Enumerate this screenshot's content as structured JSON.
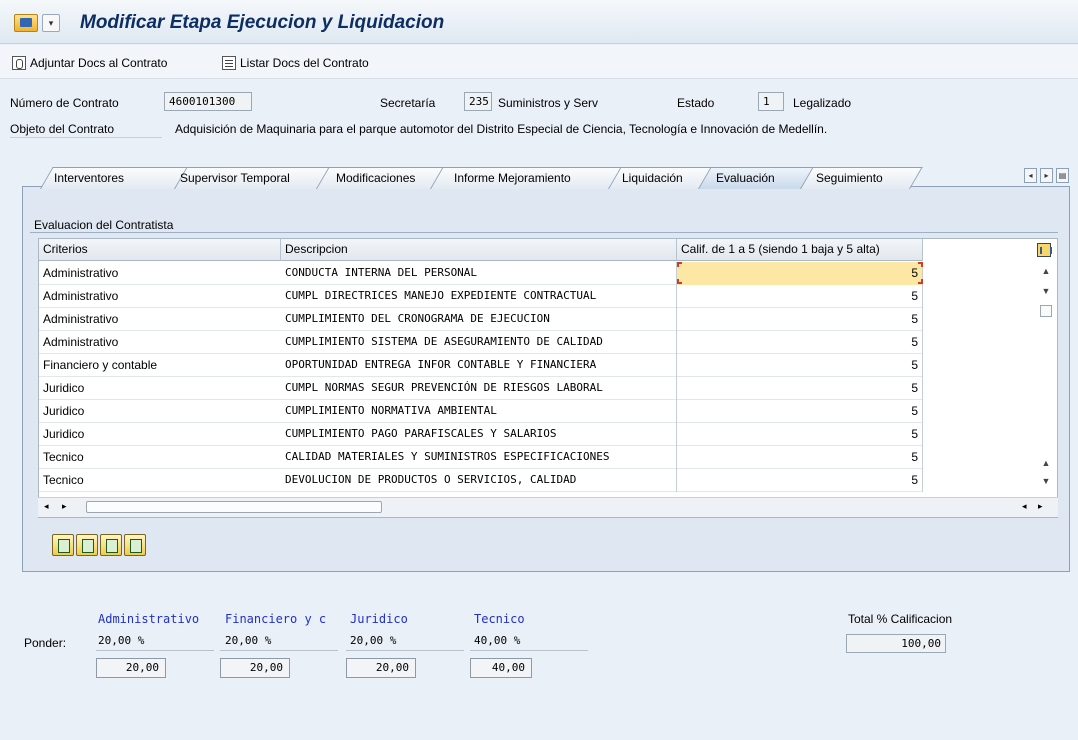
{
  "window": {
    "title": "Modificar Etapa Ejecucion y Liquidacion"
  },
  "toolbar": {
    "attach_label": "Adjuntar Docs al Contrato",
    "list_label": "Listar Docs del Contrato"
  },
  "header": {
    "contract_number_label": "Número de Contrato",
    "contract_number": "4600101300",
    "secretaria_label": "Secretaría",
    "secretaria_code": "235",
    "secretaria_name": "Suministros y Serv",
    "estado_label": "Estado",
    "estado_code": "1",
    "estado_name": "Legalizado",
    "objeto_label": "Objeto del Contrato",
    "objeto_text": "Adquisición de Maquinaria para el parque automotor del Distrito Especial de Ciencia, Tecnología e Innovación de Medellín."
  },
  "tabs": [
    {
      "label": "Interventores"
    },
    {
      "label": "Supervisor Temporal"
    },
    {
      "label": "Modificaciones"
    },
    {
      "label": "Informe Mejoramiento"
    },
    {
      "label": "Liquidación"
    },
    {
      "label": "Evaluación",
      "active": true
    },
    {
      "label": "Seguimiento"
    }
  ],
  "evaluation": {
    "group_title": "Evaluacion del Contratista",
    "columns": [
      "Criterios",
      "Descripcion",
      "Calif. de 1 a 5 (siendo 1 baja y 5 alta)"
    ],
    "rows": [
      {
        "criterio": "Administrativo",
        "descripcion": "CONDUCTA INTERNA DEL PERSONAL",
        "calif": "5"
      },
      {
        "criterio": "Administrativo",
        "descripcion": "CUMPL DIRECTRICES MANEJO EXPEDIENTE CONTRACTUAL",
        "calif": "5"
      },
      {
        "criterio": "Administrativo",
        "descripcion": "CUMPLIMIENTO DEL CRONOGRAMA DE EJECUCION",
        "calif": "5"
      },
      {
        "criterio": "Administrativo",
        "descripcion": "CUMPLIMIENTO SISTEMA DE ASEGURAMIENTO DE CALIDAD",
        "calif": "5"
      },
      {
        "criterio": "Financiero y contable",
        "descripcion": "OPORTUNIDAD ENTREGA INFOR CONTABLE Y FINANCIERA",
        "calif": "5"
      },
      {
        "criterio": "Juridico",
        "descripcion": "CUMPL NORMAS SEGUR PREVENCIÓN DE RIESGOS LABORAL",
        "calif": "5"
      },
      {
        "criterio": "Juridico",
        "descripcion": "CUMPLIMIENTO NORMATIVA AMBIENTAL",
        "calif": "5"
      },
      {
        "criterio": "Juridico",
        "descripcion": "CUMPLIMIENTO PAGO PARAFISCALES Y SALARIOS",
        "calif": "5"
      },
      {
        "criterio": "Tecnico",
        "descripcion": "CALIDAD MATERIALES Y SUMINISTROS ESPECIFICACIONES",
        "calif": "5"
      },
      {
        "criterio": "Tecnico",
        "descripcion": "DEVOLUCION DE PRODUCTOS O SERVICIOS, CALIDAD",
        "calif": "5"
      }
    ]
  },
  "summary": {
    "ponder_label": "Ponder:",
    "total_label": "Total % Calificacion",
    "total_value": "100,00",
    "categories": [
      {
        "name": "Administrativo",
        "pct": "20,00 %",
        "value": "20,00"
      },
      {
        "name": "Financiero y c",
        "pct": "20,00 %",
        "value": "20,00"
      },
      {
        "name": "Juridico",
        "pct": "20,00 %",
        "value": "20,00"
      },
      {
        "name": "Tecnico",
        "pct": "40,00 %",
        "value": "40,00"
      }
    ]
  },
  "icons": {
    "title": "sap-transaction-icon",
    "attach": "paperclip-icon",
    "list": "document-list-icon"
  }
}
